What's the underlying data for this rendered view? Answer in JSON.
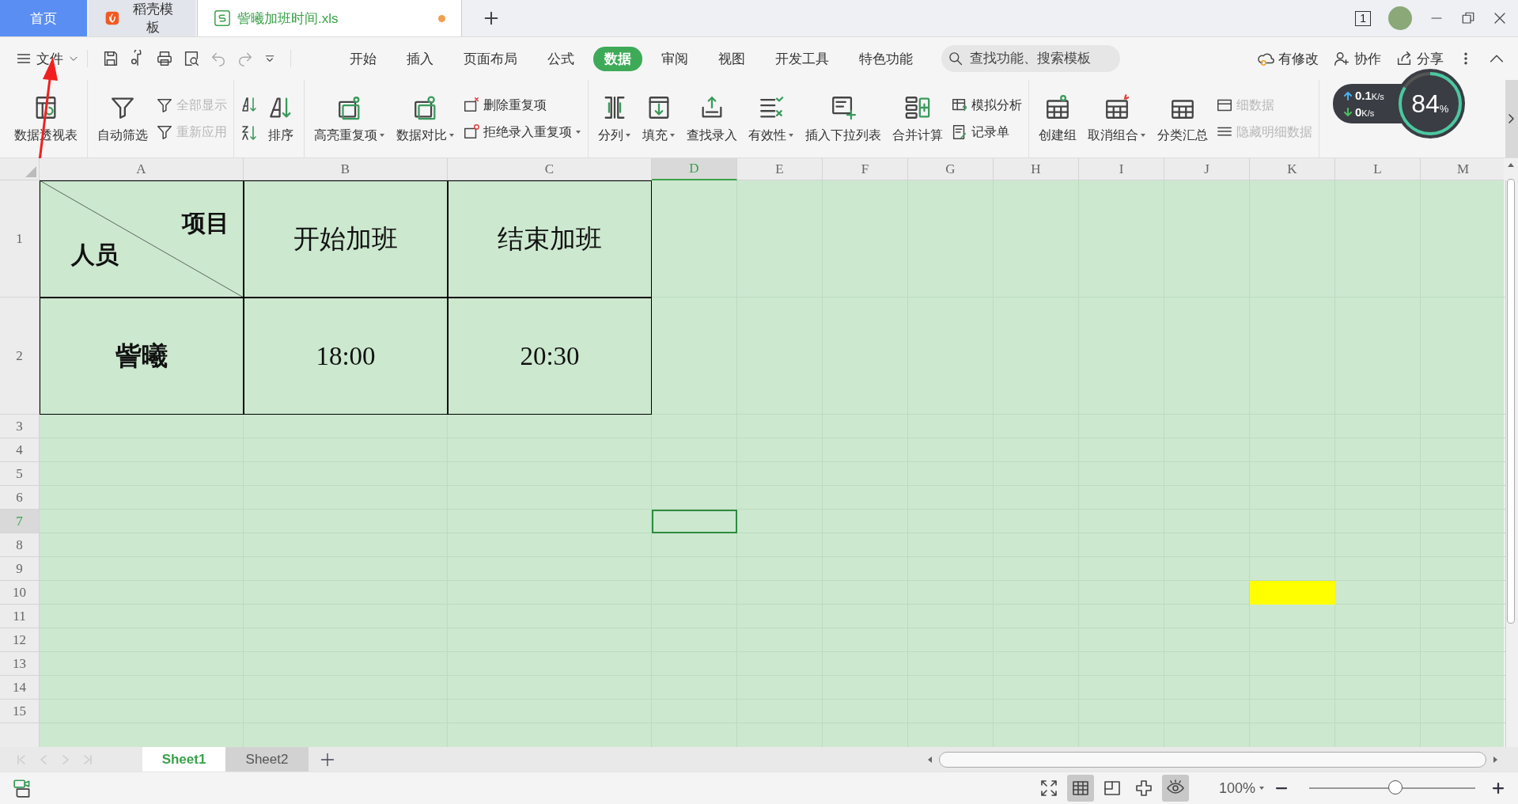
{
  "title_tabs": [
    {
      "kind": "home",
      "label": "首页",
      "selected": false
    },
    {
      "kind": "docer",
      "label": "稻壳模板",
      "selected": false
    },
    {
      "kind": "file",
      "label": "訾曦加班时间.xls",
      "selected": true,
      "modified": true
    }
  ],
  "window": {
    "count": "1"
  },
  "menu": {
    "label": "文件"
  },
  "ribbon_tabs": [
    {
      "label": "开始",
      "selected": false
    },
    {
      "label": "插入",
      "selected": false
    },
    {
      "label": "页面布局",
      "selected": false
    },
    {
      "label": "公式",
      "selected": false
    },
    {
      "label": "数据",
      "selected": true
    },
    {
      "label": "审阅",
      "selected": false
    },
    {
      "label": "视图",
      "selected": false
    },
    {
      "label": "开发工具",
      "selected": false
    },
    {
      "label": "特色功能",
      "selected": false
    }
  ],
  "search": {
    "placeholder": "查找功能、搜索模板"
  },
  "actions": [
    {
      "label": "有修改"
    },
    {
      "label": "协作"
    },
    {
      "label": "分享"
    }
  ],
  "ribbon": {
    "groups": [
      {
        "items": [
          {
            "kind": "large",
            "label": "数据透视表",
            "dropdown": false
          }
        ]
      },
      {
        "items": [
          {
            "kind": "large",
            "label": "自动筛选",
            "dropdown": false
          },
          {
            "kind": "stack",
            "items": [
              {
                "label": "全部显示",
                "disabled": true
              },
              {
                "label": "重新应用",
                "disabled": true
              }
            ]
          }
        ]
      },
      {
        "items": [
          {
            "kind": "sort_pair"
          },
          {
            "kind": "large",
            "label": "排序",
            "dropdown": false
          }
        ]
      },
      {
        "items": [
          {
            "kind": "large",
            "label": "高亮重复项",
            "dropdown": true
          },
          {
            "kind": "large",
            "label": "数据对比",
            "dropdown": true
          },
          {
            "kind": "stack",
            "items": [
              {
                "label": "删除重复项",
                "disabled": false,
                "dropdown": false
              },
              {
                "label": "拒绝录入重复项",
                "disabled": false,
                "dropdown": true
              }
            ]
          }
        ]
      },
      {
        "items": [
          {
            "kind": "large",
            "label": "分列",
            "dropdown": true
          },
          {
            "kind": "large",
            "label": "填充",
            "dropdown": true
          },
          {
            "kind": "large",
            "label": "查找录入",
            "dropdown": false
          },
          {
            "kind": "large",
            "label": "有效性",
            "dropdown": true
          },
          {
            "kind": "large",
            "label": "插入下拉列表",
            "dropdown": false
          },
          {
            "kind": "large",
            "label": "合并计算",
            "dropdown": false
          },
          {
            "kind": "stack",
            "items": [
              {
                "label": "模拟分析",
                "disabled": false,
                "dropdown": false
              },
              {
                "label": "记录单",
                "disabled": false,
                "dropdown": false
              }
            ]
          }
        ]
      },
      {
        "items": [
          {
            "kind": "large",
            "label": "创建组",
            "dropdown": false
          },
          {
            "kind": "large",
            "label": "取消组合",
            "dropdown": true
          },
          {
            "kind": "large",
            "label": "分类汇总",
            "dropdown": false
          },
          {
            "kind": "stack",
            "items": [
              {
                "label": "细数据",
                "disabled": true,
                "dropdown": false
              },
              {
                "label": "隐藏明细数据",
                "disabled": true,
                "dropdown": false
              }
            ]
          }
        ]
      }
    ]
  },
  "speed_widget": {
    "up": "0.1",
    "up_unit": "K/s",
    "down": "0",
    "down_unit": "K/s",
    "value": "84",
    "value_unit": "%",
    "level": 0.84
  },
  "sheet": {
    "columns": [
      {
        "label": "A",
        "selected": false
      },
      {
        "label": "B",
        "selected": false
      },
      {
        "label": "C",
        "selected": false
      },
      {
        "label": "D",
        "selected": true
      },
      {
        "label": "E",
        "selected": false
      },
      {
        "label": "F",
        "selected": false
      },
      {
        "label": "G",
        "selected": false
      },
      {
        "label": "H",
        "selected": false
      },
      {
        "label": "I",
        "selected": false
      },
      {
        "label": "J",
        "selected": false
      },
      {
        "label": "K",
        "selected": false
      },
      {
        "label": "L",
        "selected": false
      },
      {
        "label": "M",
        "selected": false
      }
    ],
    "rows": [
      {
        "label": "1",
        "selected": false,
        "cells": [
          {
            "kind": "diagonal",
            "top_right": "项目",
            "bottom_left": "人员"
          },
          {
            "kind": "text",
            "text": "开始加班",
            "bold": false
          },
          {
            "kind": "text",
            "text": "结束加班",
            "bold": false
          }
        ]
      },
      {
        "label": "2",
        "selected": false,
        "cells": [
          {
            "kind": "text",
            "text": "訾曦",
            "bold": true
          },
          {
            "kind": "text",
            "text": "18:00",
            "bold": false
          },
          {
            "kind": "text",
            "text": "20:30",
            "bold": false
          }
        ]
      },
      {
        "label": "3",
        "selected": false
      },
      {
        "label": "4",
        "selected": false
      },
      {
        "label": "5",
        "selected": false
      },
      {
        "label": "6",
        "selected": false
      },
      {
        "label": "7",
        "selected": true,
        "cells": [
          {
            "kind": "blank"
          },
          {
            "kind": "blank"
          },
          {
            "kind": "blank"
          },
          {
            "kind": "cursor"
          }
        ]
      },
      {
        "label": "8",
        "selected": false
      },
      {
        "label": "9",
        "selected": false
      },
      {
        "label": "10",
        "selected": false,
        "cells": [
          {
            "kind": "blank"
          },
          {
            "kind": "blank"
          },
          {
            "kind": "blank"
          },
          {
            "kind": "blank"
          },
          {
            "kind": "blank"
          },
          {
            "kind": "blank"
          },
          {
            "kind": "blank"
          },
          {
            "kind": "blank"
          },
          {
            "kind": "blank"
          },
          {
            "kind": "blank"
          },
          {
            "kind": "fill",
            "color": "#ffff00"
          }
        ]
      },
      {
        "label": "11",
        "selected": false
      },
      {
        "label": "12",
        "selected": false
      },
      {
        "label": "13",
        "selected": false
      },
      {
        "label": "14",
        "selected": false
      },
      {
        "label": "15",
        "selected": false
      }
    ]
  },
  "sheet_tabs": [
    {
      "label": "Sheet1",
      "selected": true
    },
    {
      "label": "Sheet2",
      "selected": false
    }
  ],
  "status_bar": {
    "view_buttons": [
      {
        "selected": false
      },
      {
        "selected": true
      },
      {
        "selected": false
      },
      {
        "selected": false
      },
      {
        "selected": true
      }
    ],
    "zoom": "100%",
    "zoom_slider": {
      "level": 0.52
    }
  }
}
